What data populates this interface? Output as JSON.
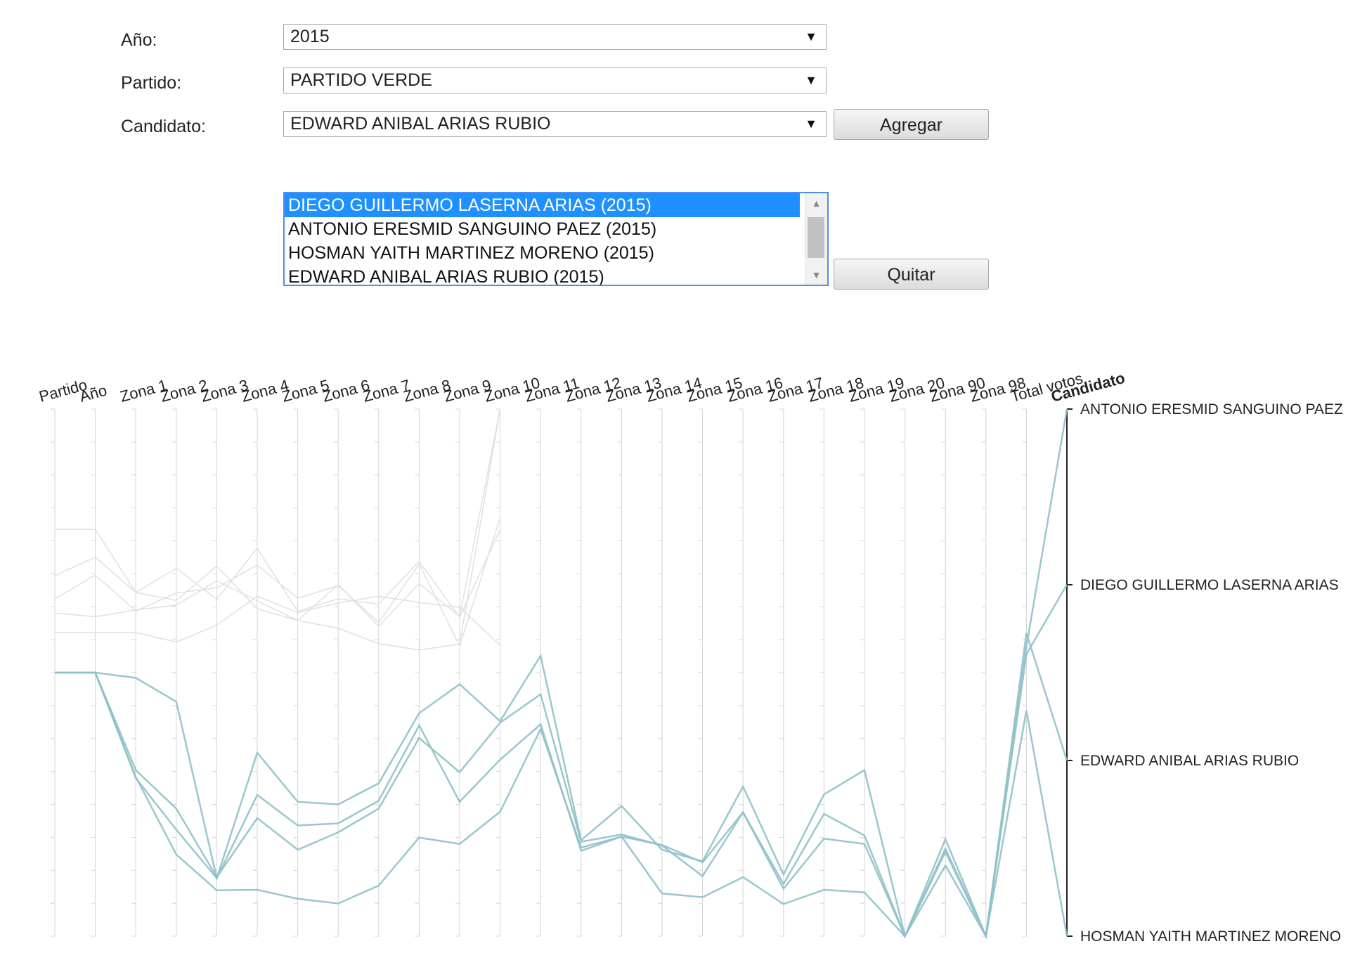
{
  "form": {
    "anio_label": "Año:",
    "anio_value": "2015",
    "partido_label": "Partido:",
    "partido_value": "PARTIDO VERDE",
    "candidato_label": "Candidato:",
    "candidato_value": "EDWARD ANIBAL ARIAS RUBIO",
    "agregar_label": "Agregar",
    "quitar_label": "Quitar",
    "dropdown_arrow": "▼",
    "list_items": [
      "DIEGO GUILLERMO LASERNA ARIAS (2015)",
      "ANTONIO ERESMID SANGUINO PAEZ (2015)",
      "HOSMAN YAITH MARTINEZ MORENO (2015)",
      "EDWARD ANIBAL ARIAS RUBIO (2015)"
    ],
    "selected_index": 0
  },
  "colors": {
    "line": "#8fc1c9",
    "faded_line": "#e0e0e0",
    "axis": "#d4d4d4",
    "selected_bg": "#1e90ff",
    "listbox_border": "#4d8ef0"
  },
  "chart_data": {
    "type": "parallel-coordinates",
    "dimensions": [
      "Partido",
      "Año",
      "Zona 1",
      "Zona 2",
      "Zona 3",
      "Zona 4",
      "Zona 5",
      "Zona 6",
      "Zona 7",
      "Zona 8",
      "Zona 9",
      "Zona 10",
      "Zona 11",
      "Zona 12",
      "Zona 13",
      "Zona 14",
      "Zona 15",
      "Zona 16",
      "Zona 17",
      "Zona 18",
      "Zona 19",
      "Zona 20",
      "Zona 90",
      "Zona 98",
      "Total votos",
      "Candidato"
    ],
    "candidate_axis": [
      "ANTONIO ERESMID SANGUINO PAEZ",
      "DIEGO GUILLERMO LASERNA ARIAS",
      "EDWARD ANIBAL ARIAS RUBIO",
      "HOSMAN YAITH MARTINEZ MORENO"
    ],
    "value_scale": "axis top = 0, axis bottom = 1",
    "series": [
      {
        "values": [
          0.5,
          0.5,
          0.51,
          0.555,
          0.89,
          0.652,
          0.745,
          0.75,
          0.71,
          0.577,
          0.522,
          0.592,
          0.468,
          0.818,
          0.753,
          0.836,
          0.858,
          0.716,
          0.883,
          0.731,
          0.685,
          1.0,
          0.816,
          1.0,
          0.45,
          0.0
        ]
      },
      {
        "values": [
          0.5,
          0.5,
          0.685,
          0.758,
          0.888,
          0.776,
          0.836,
          0.803,
          0.758,
          0.624,
          0.689,
          0.595,
          0.541,
          0.821,
          0.807,
          0.828,
          0.886,
          0.765,
          0.901,
          0.768,
          0.809,
          1.0,
          0.834,
          1.0,
          0.465,
          0.333
        ]
      },
      {
        "values": [
          0.5,
          0.5,
          0.7,
          0.798,
          0.89,
          0.732,
          0.79,
          0.786,
          0.743,
          0.6,
          0.745,
          0.665,
          0.598,
          0.838,
          0.811,
          0.827,
          0.86,
          0.765,
          0.91,
          0.815,
          0.825,
          1.0,
          0.84,
          1.0,
          0.425,
          0.667
        ]
      },
      {
        "values": [
          0.5,
          0.5,
          0.698,
          0.845,
          0.913,
          0.912,
          0.929,
          0.938,
          0.904,
          0.813,
          0.825,
          0.764,
          0.607,
          0.832,
          0.811,
          0.919,
          0.926,
          0.888,
          0.939,
          0.912,
          0.917,
          1.0,
          0.866,
          1.0,
          0.572,
          1.0
        ]
      }
    ],
    "faded_series": [
      {
        "values": [
          0.228,
          0.228,
          0.348,
          0.302,
          0.361,
          0.264,
          0.384,
          0.36,
          0.37,
          0.289,
          0.395,
          0.229
        ]
      },
      {
        "values": [
          0.36,
          0.315,
          0.383,
          0.349,
          0.339,
          0.296,
          0.359,
          0.335,
          0.405,
          0.294,
          0.45,
          0.206
        ]
      },
      {
        "values": [
          0.387,
          0.394,
          0.381,
          0.372,
          0.326,
          0.364,
          0.401,
          0.333,
          0.412,
          0.331,
          0.393,
          0.0
        ]
      },
      {
        "values": [
          0.316,
          0.281,
          0.348,
          0.363,
          0.298,
          0.379,
          0.401,
          0.416,
          0.445,
          0.457,
          0.446,
          0.0
        ]
      },
      {
        "values": [
          0.424,
          0.424,
          0.424,
          0.442,
          0.41,
          0.355,
          0.386,
          0.368,
          0.355,
          0.367,
          0.376,
          0.448
        ]
      }
    ]
  }
}
